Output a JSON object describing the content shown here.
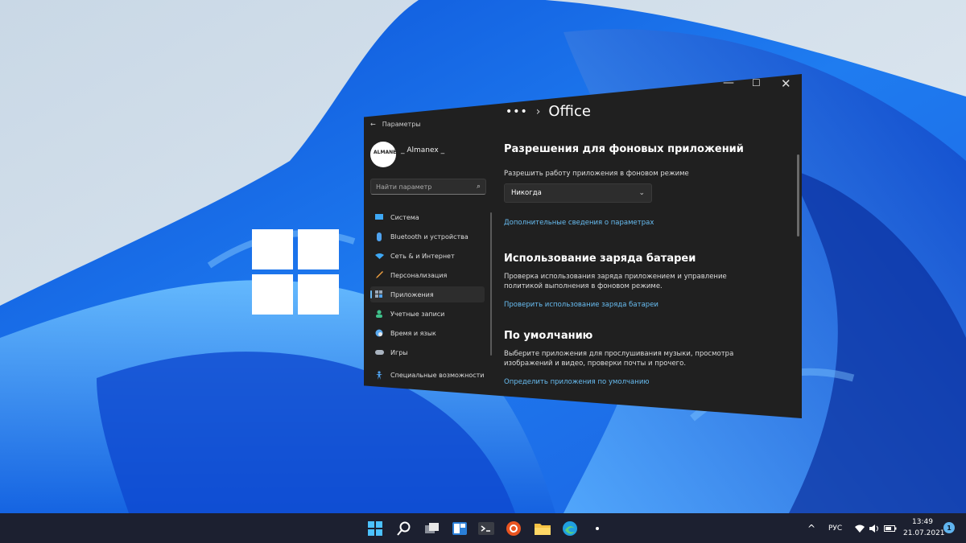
{
  "window": {
    "app_title": "Параметры",
    "user_name": "_ Almanex _",
    "avatar_text": "ALMANEX",
    "search_placeholder": "Найти параметр",
    "breadcrumb_ellipsis": "•••",
    "breadcrumb_page": "Office"
  },
  "sidebar": {
    "items": [
      {
        "label": "Система",
        "icon": "monitor-icon"
      },
      {
        "label": "Bluetooth и устройства",
        "icon": "bluetooth-icon"
      },
      {
        "label": "Сеть & и Интернет",
        "icon": "wifi-icon"
      },
      {
        "label": "Персонализация",
        "icon": "brush-icon"
      },
      {
        "label": "Приложения",
        "icon": "apps-icon",
        "active": true
      },
      {
        "label": "Учетные записи",
        "icon": "person-icon"
      },
      {
        "label": "Время и язык",
        "icon": "globe-clock-icon"
      },
      {
        "label": "Игры",
        "icon": "gamepad-icon"
      },
      {
        "label": "Специальные возможности",
        "icon": "accessibility-icon"
      }
    ]
  },
  "content": {
    "background": {
      "title": "Разрешения для фоновых приложений",
      "label": "Разрешить работу приложения в фоновом режиме",
      "dropdown_value": "Никогда",
      "link": "Дополнительные сведения о параметрах"
    },
    "battery": {
      "title": "Использование заряда батареи",
      "description": "Проверка использования заряда приложением и управление политикой выполнения в фоновом режиме.",
      "link": "Проверить использование заряда батареи"
    },
    "defaults": {
      "title": "По умолчанию",
      "description": "Выберите приложения для прослушивания музыки, просмотра изображений и видео, проверки почты и прочего.",
      "link": "Определить приложения по умолчанию"
    }
  },
  "taskbar": {
    "language": "РУС",
    "time": "13:49",
    "date": "21.07.2021",
    "notifications": "1"
  },
  "colors": {
    "accent": "#68bdf2",
    "window_bg": "#202020",
    "taskbar_bg": "#1c2030",
    "wallpaper_blue": "#1a6fe8"
  }
}
